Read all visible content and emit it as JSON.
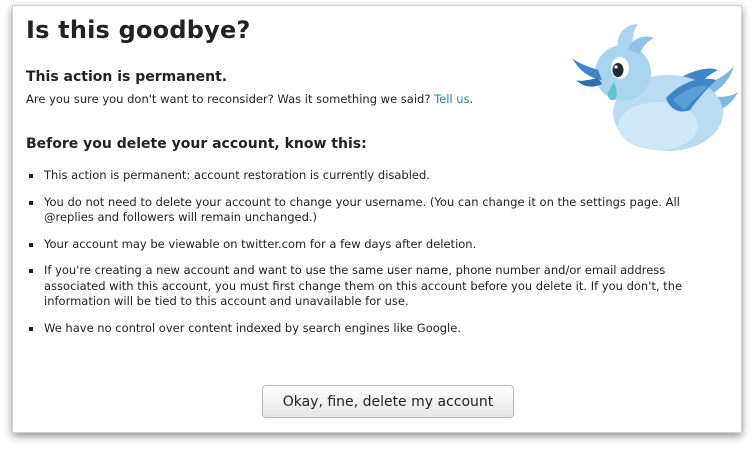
{
  "page": {
    "title": "Is this goodbye?"
  },
  "permanent_notice": {
    "heading": "This action is permanent.",
    "text": "Are you sure you don't want to reconsider? Was it something we said?",
    "link_label": "Tell us",
    "trailing": "."
  },
  "before_delete": {
    "heading": "Before you delete your account, know this:",
    "items": [
      {
        "text": "This action is permanent: account restoration is currently disabled."
      },
      {
        "text": "You do not need to delete your account to change your username. (You can change it on the settings page. All @replies and followers will remain unchanged.)"
      },
      {
        "text": "Your account may be viewable on twitter.com for a few days after deletion."
      },
      {
        "text": "If you're creating a new account and want to use the same user name, phone number and/or email address associated with this account, you must first change them on this account before you delete it. If you don't, the information will be tied to this account and unavailable for use."
      },
      {
        "text": "We have no control over content indexed by search engines like Google."
      }
    ]
  },
  "actions": {
    "delete_label": "Okay, fine, delete my account"
  },
  "mascot": {
    "icon": "crying-bird-icon"
  },
  "colors": {
    "link": "#2a7fbf",
    "bird_light": "#a9d4ee",
    "bird_dark": "#3f86c8"
  }
}
